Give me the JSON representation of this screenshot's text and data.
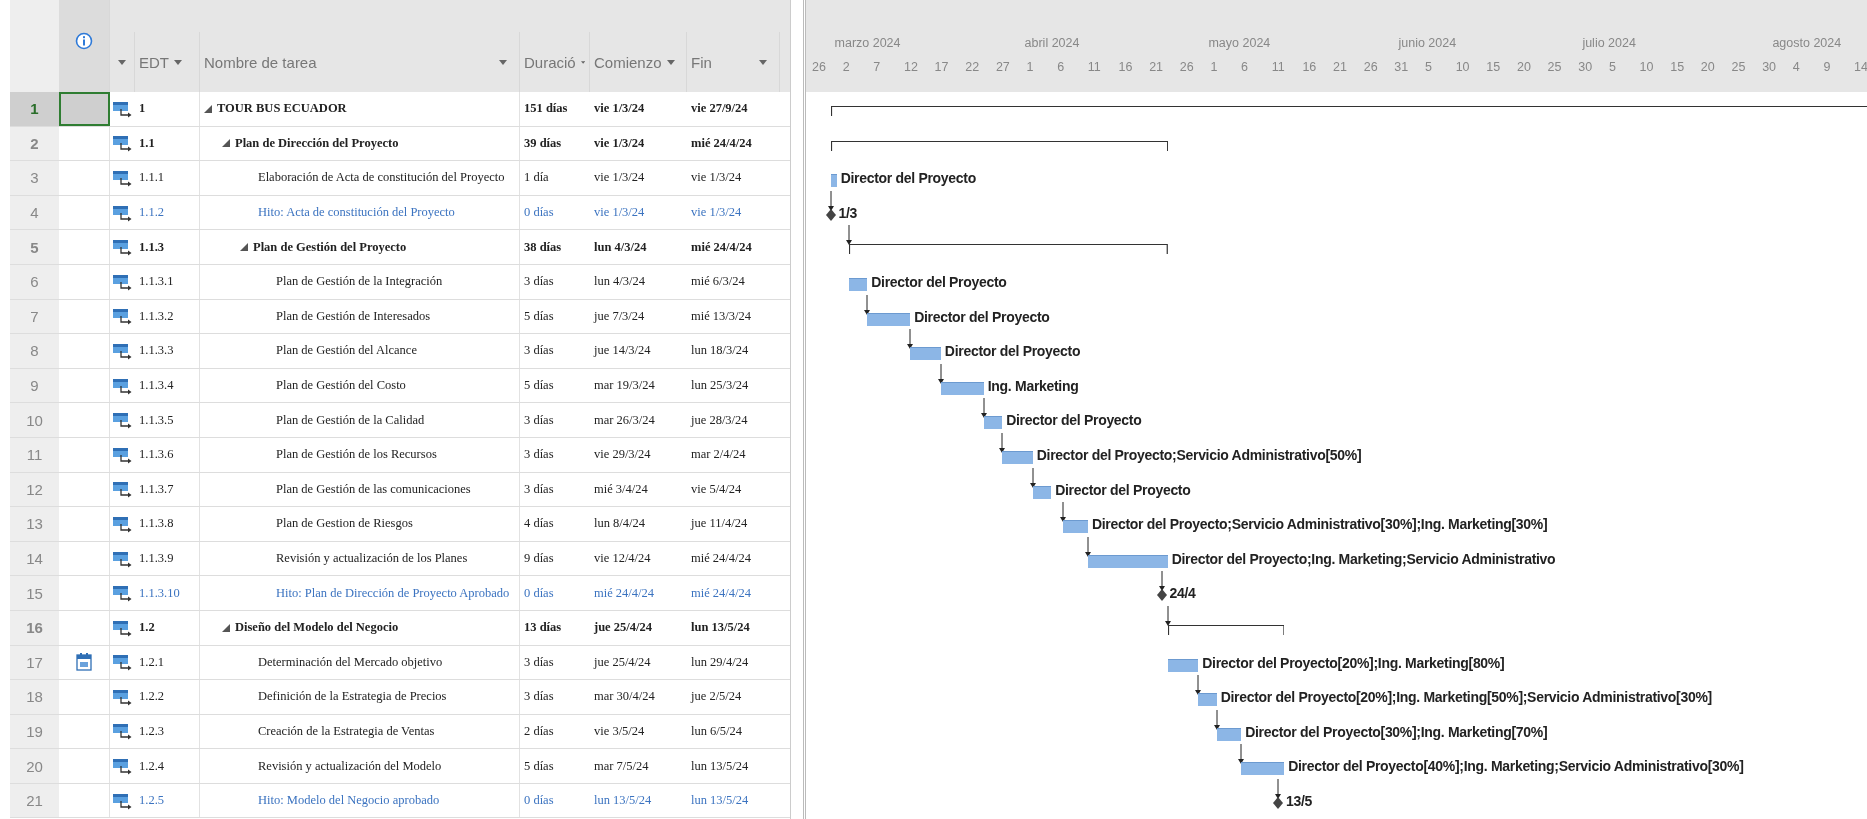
{
  "columns": {
    "edt": "EDT",
    "name": "Nombre de tarea",
    "duration": "Duració",
    "start": "Comienzo",
    "finish": "Fin"
  },
  "timeline": {
    "months": [
      "marzo 2024",
      "abril 2024",
      "mayo 2024",
      "junio 2024",
      "julio 2024",
      "agosto 2024"
    ],
    "days": [
      "26",
      "2",
      "7",
      "12",
      "17",
      "22",
      "27",
      "1",
      "6",
      "11",
      "16",
      "21",
      "26",
      "1",
      "6",
      "11",
      "16",
      "21",
      "26",
      "31",
      "5",
      "10",
      "15",
      "20",
      "25",
      "30",
      "5",
      "10",
      "15",
      "20",
      "25",
      "30",
      "4",
      "9",
      "14"
    ]
  },
  "tasks": [
    {
      "id": "1",
      "edt": "1",
      "name": "TOUR BUS ECUADOR",
      "kind": "summary",
      "expanded": true,
      "duration": "151 días",
      "start": "vie 1/3/24",
      "finish": "vie 27/9/24",
      "selected": true,
      "calendar_indicator": false,
      "linked": false,
      "children": [
        {
          "id": "2",
          "edt": "1.1",
          "name": "Plan de Dirección del Proyecto",
          "kind": "summary",
          "expanded": true,
          "duration": "39 días",
          "start": "vie 1/3/24",
          "finish": "mié 24/4/24",
          "selected": false,
          "calendar_indicator": false,
          "linked": false,
          "children": [
            {
              "id": "3",
              "edt": "1.1.1",
              "name": "Elaboración de Acta de constitución del Proyecto",
              "kind": "task",
              "duration": "1 día",
              "start": "vie 1/3/24",
              "finish": "vie 1/3/24",
              "selected": false,
              "calendar_indicator": false,
              "linked": false,
              "bar_label": "Director del Proyecto"
            },
            {
              "id": "4",
              "edt": "1.1.2",
              "name": "Hito: Acta de constitución del Proyecto",
              "kind": "milestone",
              "duration": "0 días",
              "start": "vie 1/3/24",
              "finish": "vie 1/3/24",
              "selected": false,
              "calendar_indicator": false,
              "linked": true,
              "bar_label": "1/3"
            },
            {
              "id": "5",
              "edt": "1.1.3",
              "name": "Plan de Gestión del Proyecto",
              "kind": "summary",
              "expanded": true,
              "duration": "38 días",
              "start": "lun 4/3/24",
              "finish": "mié 24/4/24",
              "selected": false,
              "calendar_indicator": false,
              "linked": true,
              "children": [
                {
                  "id": "6",
                  "edt": "1.1.3.1",
                  "name": "Plan de Gestión de la Integración",
                  "kind": "task",
                  "duration": "3 días",
                  "start": "lun 4/3/24",
                  "finish": "mié 6/3/24",
                  "selected": false,
                  "calendar_indicator": false,
                  "linked": false,
                  "bar_label": "Director del Proyecto"
                },
                {
                  "id": "7",
                  "edt": "1.1.3.2",
                  "name": "Plan de Gestión de Interesados",
                  "kind": "task",
                  "duration": "5 días",
                  "start": "jue 7/3/24",
                  "finish": "mié 13/3/24",
                  "selected": false,
                  "calendar_indicator": false,
                  "linked": true,
                  "bar_label": "Director del Proyecto"
                },
                {
                  "id": "8",
                  "edt": "1.1.3.3",
                  "name": "Plan de Gestión del Alcance",
                  "kind": "task",
                  "duration": "3 días",
                  "start": "jue 14/3/24",
                  "finish": "lun 18/3/24",
                  "selected": false,
                  "calendar_indicator": false,
                  "linked": true,
                  "bar_label": "Director del Proyecto"
                },
                {
                  "id": "9",
                  "edt": "1.1.3.4",
                  "name": "Plan de Gestión del Costo",
                  "kind": "task",
                  "duration": "5 días",
                  "start": "mar 19/3/24",
                  "finish": "lun 25/3/24",
                  "selected": false,
                  "calendar_indicator": false,
                  "linked": true,
                  "bar_label": "Ing. Marketing"
                },
                {
                  "id": "10",
                  "edt": "1.1.3.5",
                  "name": "Plan de Gestión de la Calidad",
                  "kind": "task",
                  "duration": "3 días",
                  "start": "mar 26/3/24",
                  "finish": "jue 28/3/24",
                  "selected": false,
                  "calendar_indicator": false,
                  "linked": true,
                  "bar_label": "Director del Proyecto"
                },
                {
                  "id": "11",
                  "edt": "1.1.3.6",
                  "name": "Plan de Gestión de los Recursos",
                  "kind": "task",
                  "duration": "3 días",
                  "start": "vie 29/3/24",
                  "finish": "mar 2/4/24",
                  "selected": false,
                  "calendar_indicator": false,
                  "linked": true,
                  "bar_label": "Director del Proyecto;Servicio Administrativo[50%]"
                },
                {
                  "id": "12",
                  "edt": "1.1.3.7",
                  "name": "Plan de Gestión de las comunicaciones",
                  "kind": "task",
                  "duration": "3 días",
                  "start": "mié 3/4/24",
                  "finish": "vie 5/4/24",
                  "selected": false,
                  "calendar_indicator": false,
                  "linked": true,
                  "bar_label": "Director del Proyecto"
                },
                {
                  "id": "13",
                  "edt": "1.1.3.8",
                  "name": "Plan de Gestion de Riesgos",
                  "kind": "task",
                  "duration": "4 días",
                  "start": "lun 8/4/24",
                  "finish": "jue 11/4/24",
                  "selected": false,
                  "calendar_indicator": false,
                  "linked": true,
                  "bar_label": "Director del Proyecto;Servicio Administrativo[30%];Ing. Marketing[30%]"
                },
                {
                  "id": "14",
                  "edt": "1.1.3.9",
                  "name": "Revisión y actualización de los Planes",
                  "kind": "task",
                  "duration": "9 días",
                  "start": "vie 12/4/24",
                  "finish": "mié 24/4/24",
                  "selected": false,
                  "calendar_indicator": false,
                  "linked": true,
                  "bar_label": "Director del Proyecto;Ing. Marketing;Servicio Administrativo"
                },
                {
                  "id": "15",
                  "edt": "1.1.3.10",
                  "name": "Hito: Plan de Dirección de Proyecto Aprobado",
                  "kind": "milestone",
                  "duration": "0 días",
                  "start": "mié 24/4/24",
                  "finish": "mié 24/4/24",
                  "selected": false,
                  "calendar_indicator": false,
                  "linked": true,
                  "bar_label": "24/4"
                }
              ]
            }
          ]
        },
        {
          "id": "16",
          "edt": "1.2",
          "name": "Diseño del Modelo del Negocio",
          "kind": "summary",
          "expanded": true,
          "duration": "13 días",
          "start": "jue 25/4/24",
          "finish": "lun 13/5/24",
          "selected": false,
          "calendar_indicator": false,
          "linked": true,
          "children": [
            {
              "id": "17",
              "edt": "1.2.1",
              "name": "Determinación del Mercado objetivo",
              "kind": "task",
              "duration": "3 días",
              "start": "jue 25/4/24",
              "finish": "lun 29/4/24",
              "selected": false,
              "calendar_indicator": true,
              "linked": false,
              "bar_label": "Director del Proyecto[20%];Ing. Marketing[80%]"
            },
            {
              "id": "18",
              "edt": "1.2.2",
              "name": "Definición de la Estrategia de Precios",
              "kind": "task",
              "duration": "3 días",
              "start": "mar 30/4/24",
              "finish": "jue 2/5/24",
              "selected": false,
              "calendar_indicator": false,
              "linked": true,
              "bar_label": "Director del Proyecto[20%];Ing. Marketing[50%];Servicio Administrativo[30%]"
            },
            {
              "id": "19",
              "edt": "1.2.3",
              "name": "Creación de la Estrategia de Ventas",
              "kind": "task",
              "duration": "2 días",
              "start": "vie 3/5/24",
              "finish": "lun 6/5/24",
              "selected": false,
              "calendar_indicator": false,
              "linked": true,
              "bar_label": "Director del Proyecto[30%];Ing. Marketing[70%]"
            },
            {
              "id": "20",
              "edt": "1.2.4",
              "name": "Revisión y actualización del Modelo",
              "kind": "task",
              "duration": "5 días",
              "start": "mar 7/5/24",
              "finish": "lun 13/5/24",
              "selected": false,
              "calendar_indicator": false,
              "linked": true,
              "bar_label": "Director del Proyecto[40%];Ing. Marketing;Servicio Administrativo[30%]"
            },
            {
              "id": "21",
              "edt": "1.2.5",
              "name": "Hito: Modelo del Negocio aprobado",
              "kind": "milestone",
              "duration": "0 días",
              "start": "lun 13/5/24",
              "finish": "lun 13/5/24",
              "selected": false,
              "calendar_indicator": false,
              "linked": true,
              "bar_label": "13/5"
            }
          ]
        }
      ]
    }
  ]
}
